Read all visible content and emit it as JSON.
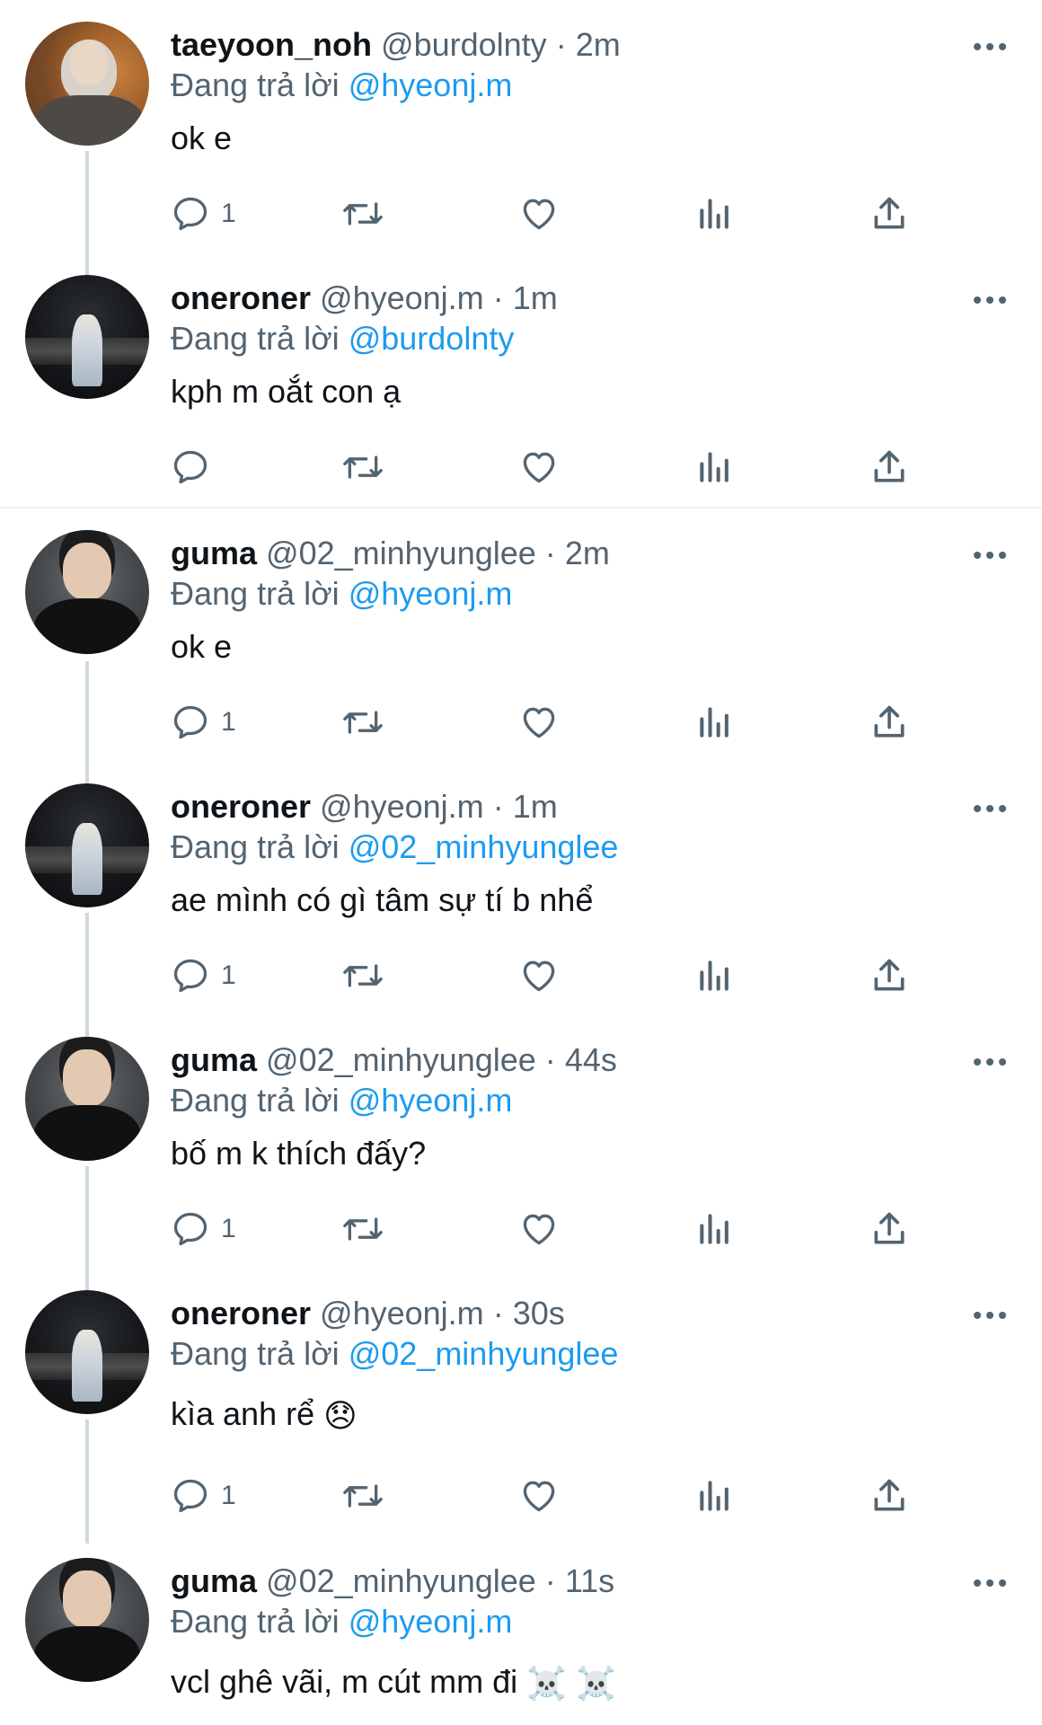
{
  "colors": {
    "text_primary": "#0f1419",
    "text_secondary": "#536471",
    "mention": "#1d9bf0",
    "thread_line": "#cfd9de",
    "divider": "#eff3f4"
  },
  "reply_prefix": "Đang trả lời",
  "tweets": [
    {
      "display_name": "taeyoon_noh",
      "handle": "@burdolnty",
      "dot": "·",
      "time": "2m",
      "reply_to": "@hyeonj.m",
      "text": "ok e",
      "reply_count": "1",
      "avatar": "taeyoon-avatar"
    },
    {
      "display_name": "oneroner",
      "handle": "@hyeonj.m",
      "dot": "·",
      "time": "1m",
      "reply_to": "@burdolnty",
      "text": "kph m oắt con ạ",
      "reply_count": "",
      "avatar": "oneroner-avatar"
    },
    {
      "display_name": "guma",
      "handle": "@02_minhyunglee",
      "dot": "·",
      "time": "2m",
      "reply_to": "@hyeonj.m",
      "text": "ok e",
      "reply_count": "1",
      "avatar": "guma-avatar"
    },
    {
      "display_name": "oneroner",
      "handle": "@hyeonj.m",
      "dot": "·",
      "time": "1m",
      "reply_to": "@02_minhyunglee",
      "text": "ae mình có gì tâm sự tí b nhể",
      "reply_count": "1",
      "avatar": "oneroner-avatar"
    },
    {
      "display_name": "guma",
      "handle": "@02_minhyunglee",
      "dot": "·",
      "time": "44s",
      "reply_to": "@hyeonj.m",
      "text": "bố m k thích đấy?",
      "reply_count": "1",
      "avatar": "guma-avatar"
    },
    {
      "display_name": "oneroner",
      "handle": "@hyeonj.m",
      "dot": "·",
      "time": "30s",
      "reply_to": "@02_minhyunglee",
      "text": "kìa anh rể",
      "emoji": "😞",
      "reply_count": "1",
      "avatar": "oneroner-avatar"
    },
    {
      "display_name": "guma",
      "handle": "@02_minhyunglee",
      "dot": "·",
      "time": "11s",
      "reply_to": "@hyeonj.m",
      "text": "vcl ghê vãi, m cút mm đi",
      "emoji": "☠️ ☠️",
      "reply_count": "",
      "avatar": "guma-avatar"
    }
  ],
  "icons": {
    "more": "more-dots-icon",
    "reply": "reply-bubble-icon",
    "retweet": "retweet-icon",
    "like": "heart-icon",
    "views": "views-bar-chart-icon",
    "share": "share-upload-icon"
  }
}
